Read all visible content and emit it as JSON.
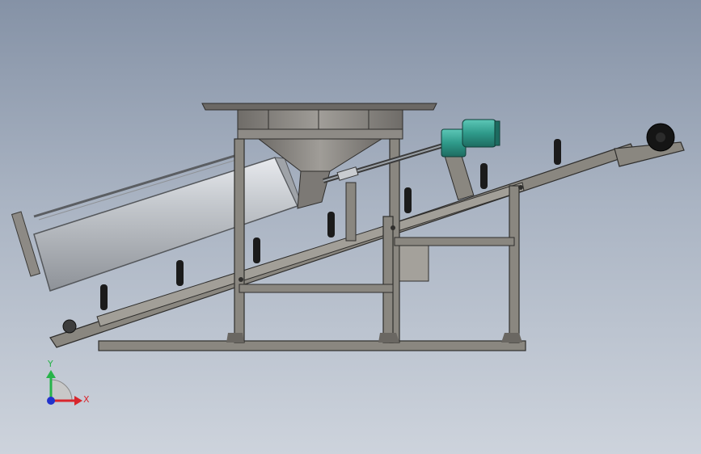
{
  "viewport": {
    "background_top": "#8592a6",
    "background_bottom": "#cdd3dc"
  },
  "model": {
    "frame_color": "#7a766f",
    "frame_edge_color": "#3a3936",
    "drum_color": "#b9bcc0",
    "hopper_color": "#8e8b86",
    "motor_color": "#2f9a8a",
    "wheel_color": "#151515"
  },
  "triad": {
    "x_label": "X",
    "y_label": "Y",
    "x_color": "#d8262d",
    "y_color": "#27b34a",
    "z_color": "#2233cc"
  }
}
